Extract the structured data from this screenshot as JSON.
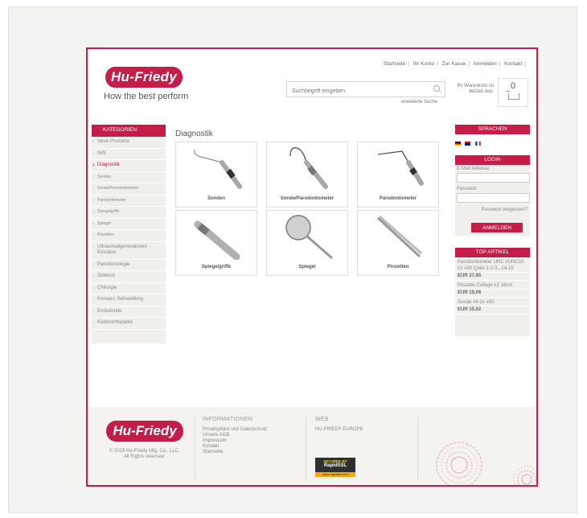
{
  "header": {
    "logo_text": "Hu-Friedy",
    "tagline": "How the best perform",
    "top_nav": [
      "Startseite",
      "Ihr Konto",
      "Zur Kasse",
      "Anmelden",
      "Kontakt"
    ],
    "search_placeholder": "Suchbegriff eingeben",
    "advanced_search": "erweiterte Suche",
    "cart_info": "Ihr Warenkorb ist derzeit leer.",
    "cart_count": "0"
  },
  "left_sidebar": {
    "title": "KATEGORIEN",
    "items": [
      {
        "label": "Neue Produkte"
      },
      {
        "label": "IMS"
      },
      {
        "label": "Diagnostik"
      },
      {
        "label": "Sonden"
      },
      {
        "label": "Sonde/Parodontometer"
      },
      {
        "label": "Parodontometer"
      },
      {
        "label": "Spiegelgriffe"
      },
      {
        "label": "Spiegel"
      },
      {
        "label": "Pinzetten"
      },
      {
        "label": "Ultraschallgeneratoren/ Einsätze"
      },
      {
        "label": "Parodontologie"
      },
      {
        "label": "Sidekick"
      },
      {
        "label": "Chirurgie"
      },
      {
        "label": "Konserv. Behandlung"
      },
      {
        "label": "Endodontie"
      },
      {
        "label": "Kieferorthopädie"
      }
    ]
  },
  "main": {
    "title": "Diagnostik",
    "tiles": [
      {
        "label": "Sonden",
        "icon": "probe-icon"
      },
      {
        "label": "Sonde/Parodontometer",
        "icon": "explorer-icon"
      },
      {
        "label": "Parodontometer",
        "icon": "periodontal-probe-icon"
      },
      {
        "label": "Spiegelgriffe",
        "icon": "mirror-handle-icon"
      },
      {
        "label": "Spiegel",
        "icon": "mirror-icon"
      },
      {
        "label": "Pinzetten",
        "icon": "tweezers-icon"
      }
    ]
  },
  "right_sidebar": {
    "languages_title": "SPRACHEN",
    "flags": [
      {
        "name": "de-flag",
        "colors": [
          "#000000",
          "#dd0000",
          "#ffce00"
        ]
      },
      {
        "name": "uk-flag",
        "colors": [
          "#012169",
          "#ffffff",
          "#c8102e"
        ]
      },
      {
        "name": "fr-flag",
        "colors": [
          "#0055a4",
          "#ffffff",
          "#ef4135"
        ]
      }
    ],
    "login": {
      "title": "LOGIN",
      "email_label": "E-Mail Adresse",
      "password_label": "Passwort",
      "forgot": "Passwort vergessen?",
      "submit": "ANMELDEN"
    },
    "top_articles": {
      "title": "TOP ARTIKEL",
      "items": [
        {
          "name": "Parodontometer UNC #UNC15 Gr #30 Qulix 1-2-3...14-15",
          "price": "EUR 27,65"
        },
        {
          "name": "Pinzette College #2 16cm",
          "price": "EUR 19,06"
        },
        {
          "name": "Sonde #9 Gr #30",
          "price": "EUR 15,02"
        }
      ]
    }
  },
  "footer": {
    "logo_text": "Hu-Friedy",
    "copyright_line1": "© 2015 Hu-Friedy Mfg. Co., LLC",
    "copyright_line2": "All Rights reserved",
    "info_title": "INFORMATIONEN",
    "info_links": [
      "Privatsphäre und Datenschutz",
      "Unsere AGB",
      "Impressum",
      "Kontakt",
      "Startseite"
    ],
    "web_title": "WEB",
    "web_links": [
      "HU-FRIEDY EUROPE"
    ],
    "ssl_line1": "SECURED BY",
    "ssl_line2": "RapidSSL",
    "ssl_line3": "www.rapidssl.com"
  },
  "colors": {
    "accent": "#c41d4a",
    "sidebar_bg": "#f0efeb",
    "footer_bg": "#f5f3ef"
  }
}
